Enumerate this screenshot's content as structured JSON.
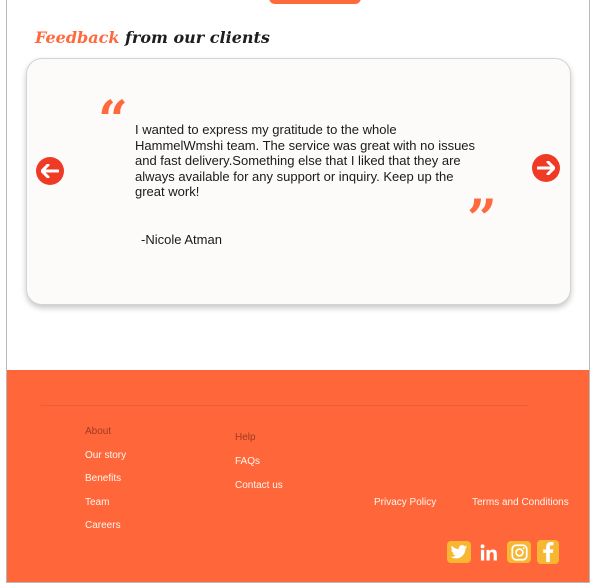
{
  "header": {
    "title_accent": "Feedback",
    "title_rest": "from our clients"
  },
  "testimonial": {
    "text": "I wanted to express my gratitude to the whole HammelWmshi team. The service was great with no issues and fast delivery.Something else that I liked that they are always available for any support or inquiry. Keep up the great work!",
    "author": "-Nicole Atman",
    "open_quote": "“",
    "close_quote": "”"
  },
  "footer": {
    "about": {
      "heading": "About",
      "links": [
        "Our story",
        "Benefits",
        "Team",
        "Careers"
      ]
    },
    "help": {
      "heading": "Help",
      "links": [
        "FAQs",
        "Contact us"
      ]
    },
    "legal": {
      "privacy": "Privacy Policy",
      "terms": "Terms and Conditions"
    },
    "social": [
      "twitter-icon",
      "linkedin-icon",
      "instagram-icon",
      "facebook-icon"
    ]
  },
  "colors": {
    "accent": "#ff6a3d",
    "arrow": "#ef3b25",
    "footer": "#ff673a",
    "social_bg": "#f7b733"
  }
}
